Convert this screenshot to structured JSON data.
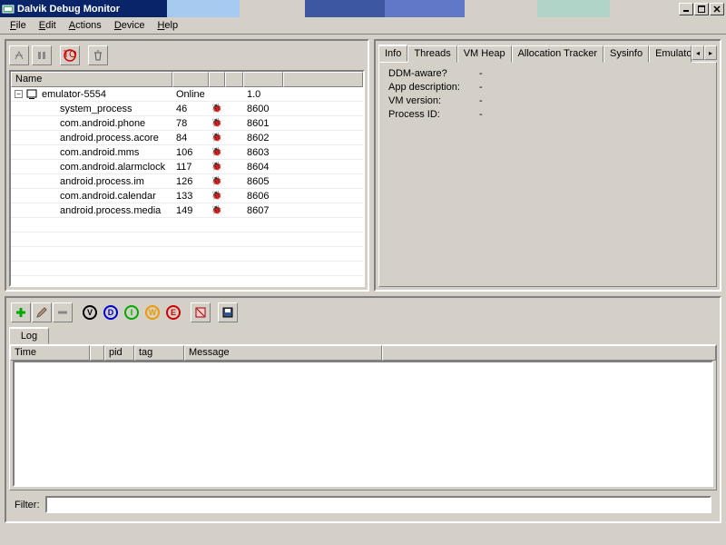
{
  "window": {
    "title": "Dalvik Debug Monitor"
  },
  "menu": {
    "file": "File",
    "edit": "Edit",
    "actions": "Actions",
    "device": "Device",
    "help": "Help"
  },
  "process_table": {
    "header": "Name",
    "device": {
      "name": "emulator-5554",
      "status": "Online",
      "version": "1.0"
    },
    "rows": [
      {
        "name": "system_process",
        "pid": "46",
        "port": "8600"
      },
      {
        "name": "com.android.phone",
        "pid": "78",
        "port": "8601"
      },
      {
        "name": "android.process.acore",
        "pid": "84",
        "port": "8602"
      },
      {
        "name": "com.android.mms",
        "pid": "106",
        "port": "8603"
      },
      {
        "name": "com.android.alarmclock",
        "pid": "117",
        "port": "8604"
      },
      {
        "name": "android.process.im",
        "pid": "126",
        "port": "8605"
      },
      {
        "name": "com.android.calendar",
        "pid": "133",
        "port": "8606"
      },
      {
        "name": "android.process.media",
        "pid": "149",
        "port": "8607"
      }
    ]
  },
  "tabs": {
    "info": "Info",
    "threads": "Threads",
    "vmheap": "VM Heap",
    "alloc": "Allocation Tracker",
    "sysinfo": "Sysinfo",
    "emu": "Emulator Con"
  },
  "info": {
    "ddm": {
      "label": "DDM-aware?",
      "val": "-"
    },
    "app": {
      "label": "App description:",
      "val": "-"
    },
    "vmv": {
      "label": "VM version:",
      "val": "-"
    },
    "pid": {
      "label": "Process ID:",
      "val": "-"
    }
  },
  "log": {
    "tab": "Log",
    "cols": {
      "time": "Time",
      "pid": "pid",
      "tag": "tag",
      "msg": "Message"
    },
    "filter_label": "Filter:",
    "filter_value": ""
  },
  "levels": {
    "v": "V",
    "d": "D",
    "i": "I",
    "w": "W",
    "e": "E"
  }
}
